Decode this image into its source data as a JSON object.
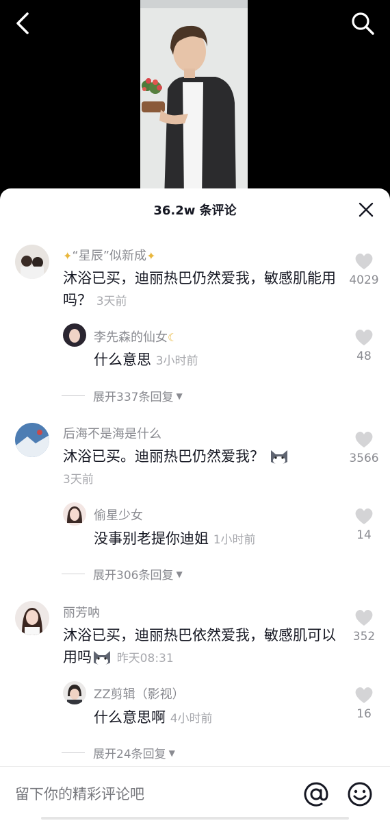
{
  "header": {
    "back_icon": "chevron-left-icon",
    "search_icon": "search-icon"
  },
  "sheet": {
    "title": "36.2w 条评论",
    "close_icon": "close-icon"
  },
  "comments": [
    {
      "username": "“星辰”似新成",
      "text": "沐浴已买，迪丽热巴仍然爱我，敏感肌能用吗？",
      "time": "3天前",
      "likes": "4029",
      "reply": {
        "username": "李先森的仙女",
        "text": "什么意思",
        "time": "3小时前",
        "likes": "48"
      },
      "expand_label": "展开337条回复"
    },
    {
      "username": "后海不是海是什么",
      "text": "沐浴已买。迪丽热巴仍然爱我？",
      "time": "3天前",
      "likes": "3566",
      "reply": {
        "username": "偷星少女",
        "text": "没事别老提你迪姐",
        "time": "1小时前",
        "likes": "14"
      },
      "expand_label": "展开306条回复"
    },
    {
      "username": "丽芳呐",
      "text": "沐浴已买，迪丽热巴依然爱我，敏感肌可以用吗",
      "time": "昨天08:31",
      "likes": "352",
      "reply": {
        "username": "ZZ剪辑（影视）",
        "text": "什么意思啊",
        "time": "4小时前",
        "likes": "16"
      },
      "expand_label": "展开24条回复"
    }
  ],
  "input": {
    "placeholder": "留下你的精彩评论吧",
    "at_icon": "at-icon",
    "emoji_icon": "emoji-icon"
  }
}
